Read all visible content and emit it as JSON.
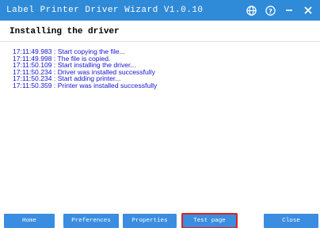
{
  "window": {
    "title": "Label Printer Driver Wizard  V1.0.10",
    "title_bar_color": "#2f8ad8",
    "icons": {
      "language": "globe-icon",
      "help": "help-icon",
      "minimize": "minimize-icon",
      "close": "close-icon"
    }
  },
  "header": {
    "title": "Installing the driver"
  },
  "log": {
    "color": "#1414d0",
    "lines": [
      "17:11:49.983 : Start copying the file...",
      "17:11:49.998 : The file is copied.",
      "17:11:50.109 : Start installing the driver...",
      "17:11:50.234 : Driver was installed successfully",
      "17:11:50.234 : Start adding printer...",
      "17:11:50.359 : Printer was installed successfully"
    ]
  },
  "buttons": {
    "home": "Home",
    "preferences": "Preferences",
    "properties": "Properties",
    "test_page": "Test page",
    "close": "Close",
    "highlight_color": "#e0231b"
  }
}
